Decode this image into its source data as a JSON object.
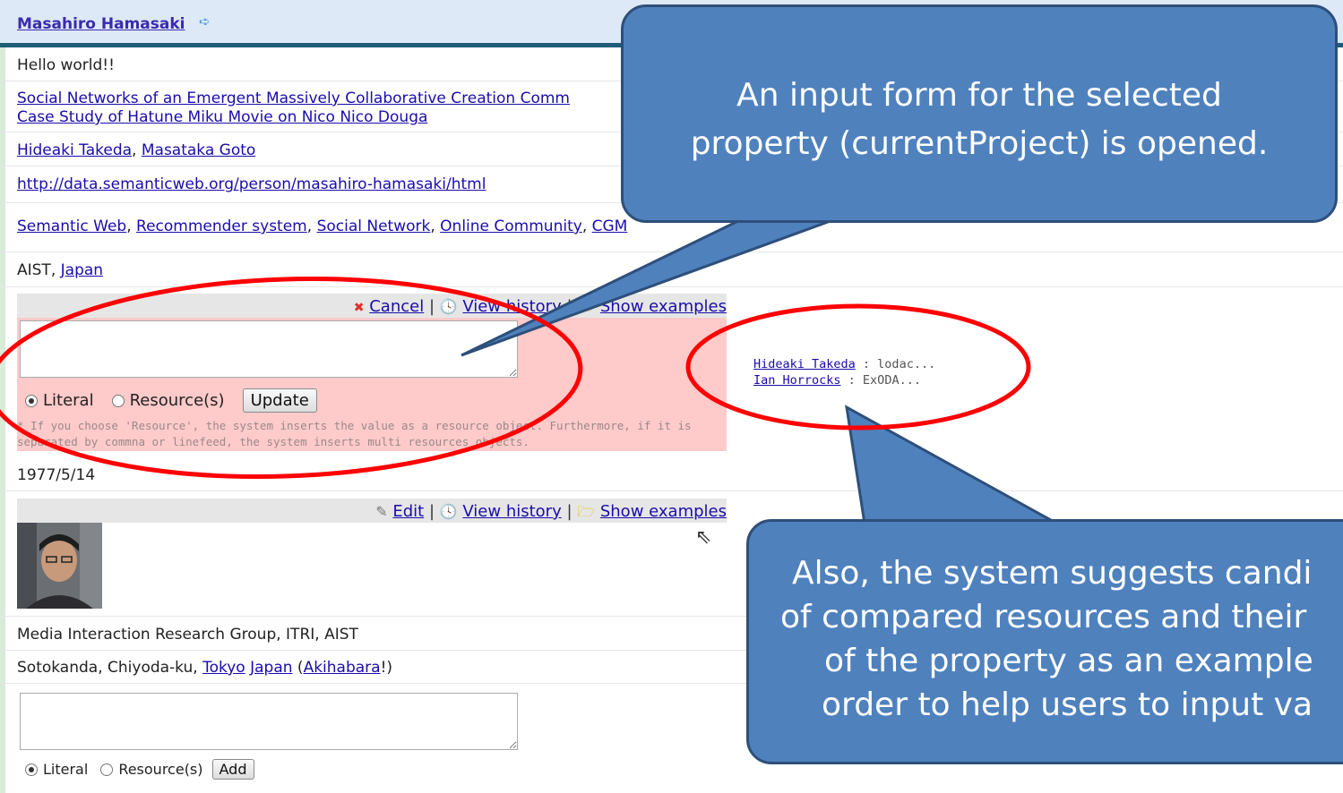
{
  "header": {
    "name": "Masahiro Hamasaki"
  },
  "rows": {
    "hello": "Hello world!!",
    "paper_line1": "Social Networks of an Emergent Massively Collaborative Creation Comm",
    "paper_line2": "Case Study of Hatune Miku Movie on Nico Nico Douga",
    "coauthor1": "Hideaki Takeda",
    "coauthor_sep": ", ",
    "coauthor2": "Masataka Goto",
    "homepage": "http://data.semanticweb.org/person/masahiro-hamasaki/html",
    "interests": [
      "Semantic Web",
      "Recommender system",
      "Social Network",
      "Online Community",
      "CGM"
    ],
    "aff_prefix": "AIST, ",
    "aff_link": "Japan",
    "birthday": "1977/5/14",
    "group": "Media Interaction Research Group, ITRI, AIST",
    "addr_prefix": "Sotokanda, Chiyoda-ku, ",
    "addr_city": "Tokyo",
    "addr_country": "Japan",
    "addr_open": " (",
    "addr_place": "Akihabara",
    "addr_close": "!)"
  },
  "edit_form": {
    "cancel": "Cancel",
    "view_history": "View history",
    "show_examples": "Show examples",
    "separator": " | ",
    "literal": "Literal",
    "resource": "Resource(s)",
    "update": "Update",
    "note": "* If you choose 'Resource', the system inserts the value as a resource object. Furthermore, if it is separated by commna or linefeed, the system inserts multi resources objects."
  },
  "suggestions": [
    {
      "name": "Hideaki Takeda",
      "value": " : lodac..."
    },
    {
      "name": "Ian Horrocks",
      "value": " : ExODA..."
    }
  ],
  "photo_bar": {
    "edit": "Edit",
    "view_history": "View history",
    "show_examples": "Show examples"
  },
  "add_form": {
    "literal": "Literal",
    "resource": "Resource(s)",
    "add": "Add"
  },
  "callouts": {
    "top": [
      "An input form for the selected",
      "property (currentProject) is opened."
    ],
    "bottom": [
      "Also, the system suggests  candi",
      "of compared resources and their",
      "of the property as an example",
      "order to help users to input va"
    ]
  },
  "colors": {
    "callout": "#4f81bd",
    "highlight": "#ff0000",
    "edit_bg": "#ffcaca",
    "header_bar": "#1f5c78"
  }
}
